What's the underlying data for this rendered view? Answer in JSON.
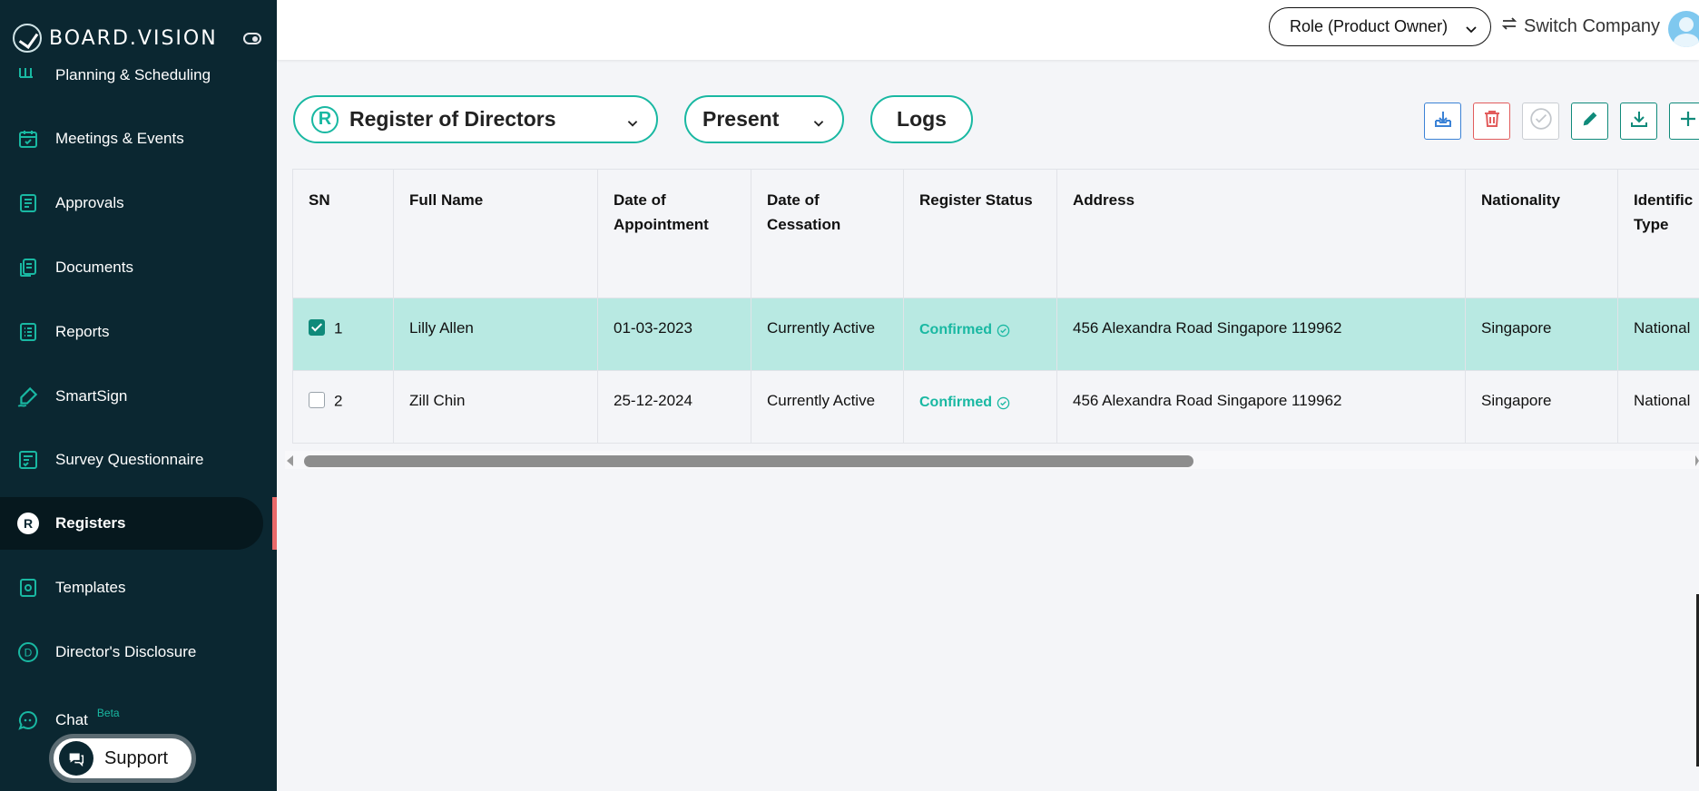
{
  "brand": {
    "name": "BOARD.VISION"
  },
  "sidebar": {
    "items": [
      {
        "label": "Planning & Scheduling",
        "icon": "calendar-grid-icon"
      },
      {
        "label": "Meetings & Events",
        "icon": "calendar-check-icon"
      },
      {
        "label": "Approvals",
        "icon": "approval-doc-icon"
      },
      {
        "label": "Documents",
        "icon": "documents-icon"
      },
      {
        "label": "Reports",
        "icon": "report-list-icon"
      },
      {
        "label": "SmartSign",
        "icon": "signature-pen-icon"
      },
      {
        "label": "Survey Questionnaire",
        "icon": "checklist-icon"
      },
      {
        "label": "Registers",
        "icon": "register-r-icon",
        "active": true
      },
      {
        "label": "Templates",
        "icon": "template-gear-icon"
      },
      {
        "label": "Director's Disclosure",
        "icon": "disclosure-d-icon"
      },
      {
        "label": "Chat",
        "icon": "chat-bubble-icon",
        "badge": "Beta"
      }
    ],
    "support_label": "Support"
  },
  "topbar": {
    "role": "Role (Product Owner)",
    "switch_company": "Switch Company"
  },
  "filters": {
    "register_badge": "R",
    "register": "Register of Directors",
    "period": "Present",
    "logs": "Logs"
  },
  "toolbar": {
    "icons": [
      "import-icon",
      "delete-icon",
      "approve-icon",
      "edit-icon",
      "download-icon",
      "add-icon"
    ]
  },
  "table": {
    "headers": [
      "SN",
      "Full Name",
      "Date of Appointment",
      "Date of Cessation",
      "Register Status",
      "Address",
      "Nationality",
      "Identification Type"
    ],
    "header_lines": {
      "appt": [
        "Date of",
        "Appointment"
      ],
      "cess": [
        "Date of",
        "Cessation"
      ],
      "id": [
        "Identific",
        "Type"
      ]
    },
    "rows": [
      {
        "sn": "1",
        "selected": true,
        "name": "Lilly Allen",
        "appointment": "01-03-2023",
        "cessation": "Currently Active",
        "status": "Confirmed",
        "address": "456 Alexandra Road Singapore 119962",
        "nationality": "Singapore",
        "id_type": "National"
      },
      {
        "sn": "2",
        "selected": false,
        "name": "Zill Chin",
        "appointment": "25-12-2024",
        "cessation": "Currently Active",
        "status": "Confirmed",
        "address": "456 Alexandra Road Singapore 119962",
        "nationality": "Singapore",
        "id_type": "National"
      }
    ]
  },
  "colors": {
    "sidebar_bg": "#0b2731",
    "accent": "#19b8a2",
    "selected_row": "#b8e9e2",
    "active_marker": "#e96a6a"
  }
}
